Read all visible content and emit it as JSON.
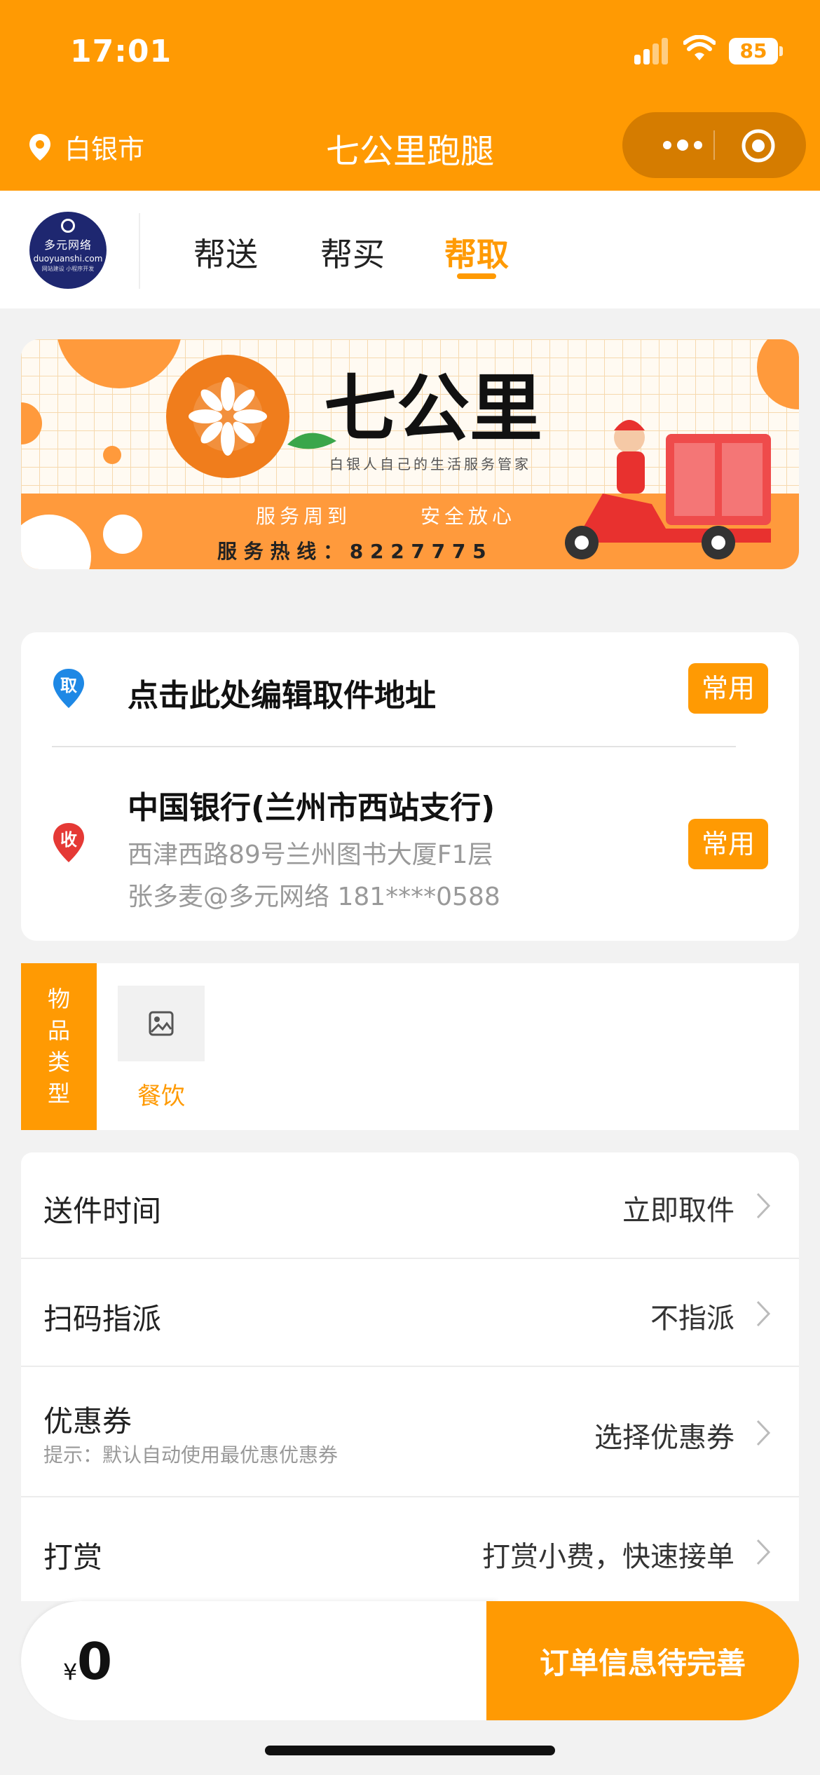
{
  "status_bar": {
    "time": "17:01",
    "battery": "85"
  },
  "header": {
    "location": "白银市",
    "title": "七公里跑腿",
    "icons": [
      "location-pin-icon",
      "more-dots-icon",
      "target-icon"
    ]
  },
  "tabs": [
    {
      "label": "帮送",
      "active": false
    },
    {
      "label": "帮买",
      "active": false
    },
    {
      "label": "帮取",
      "active": true
    }
  ],
  "logo": {
    "line1": "多元网络",
    "line2": "duoyuanshi.com",
    "line3": "网站建设 小程序开发"
  },
  "banner": {
    "brand": "七公里",
    "slogan": "白银人自己的生活服务管家",
    "tagline_left": "服务周到",
    "tagline_right": "安全放心",
    "hotline": "服 务 热 线 ： 8 2 2 7 7 7 5"
  },
  "pickup": {
    "pin_label": "取",
    "placeholder": "点击此处编辑取件地址",
    "badge": "常用"
  },
  "receiver": {
    "pin_label": "收",
    "name": "中国银行(兰州市西站支行)",
    "address": "西津西路89号兰州图书大厦F1层",
    "contact": "张多麦@多元网络 181****0588",
    "badge": "常用"
  },
  "category": {
    "label_chars": [
      "物",
      "品",
      "类",
      "型"
    ],
    "item": "餐饮"
  },
  "options": [
    {
      "label": "送件时间",
      "value": "立即取件"
    },
    {
      "label": "扫码指派",
      "value": "不指派"
    },
    {
      "label": "优惠券",
      "hint": "提示：默认自动使用最优惠优惠券",
      "value": "选择优惠券"
    },
    {
      "label": "打赏",
      "value": "打赏小费，快速接单"
    }
  ],
  "footer": {
    "currency": "¥",
    "price": "0",
    "submit_label": "订单信息待完善"
  },
  "colors": {
    "accent": "#ff9a03",
    "accent_dark": "#d57c00",
    "pickup_pin": "#1e88e5",
    "receiver_pin": "#e53935"
  }
}
